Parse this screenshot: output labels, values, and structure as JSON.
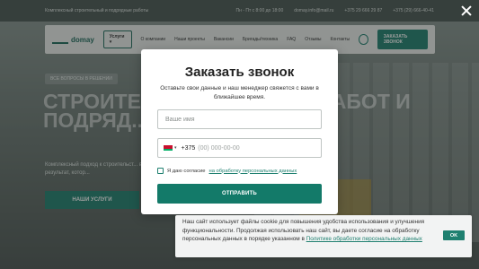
{
  "background": {
    "topbar": {
      "tagline": "Комплексный строительный и подрядные работы",
      "hours": "Пн - Пт с 8:00 до 18:00",
      "email": "domay.info@mail.ru",
      "phone1": "+375 29 666 29 87",
      "phone2": "+375 (29) 666-40-41"
    },
    "header": {
      "logo_text": "domay",
      "services_label": "Услуги ▾",
      "nav": [
        "О компании",
        "Наши проекты",
        "Вакансии",
        "Бригады/техника",
        "FAQ",
        "Отзывы",
        "Контакты"
      ],
      "call_button": "ЗАКАЗАТЬ ЗВОНОК"
    },
    "hero": {
      "badge": "ВСЕ ВОПРОСЫ В РЕШЕНИИ",
      "title": "СТРОИТЕЛ... С ПОЛНЫМ... РАБОТ И ПОДРЯД...",
      "subtitle": "Комплексный подход к строительст... вашего получить результат, котор...",
      "button": "НАШИ УСЛУГИ"
    }
  },
  "modal": {
    "title": "Заказать звонок",
    "subtitle": "Оставьте свои данные и наш менеджер свяжется с вами в ближайшее время.",
    "name_placeholder": "Ваше имя",
    "phone_code": "+375",
    "phone_mask": "(00) 000-00-00",
    "consent_prefix": "Я даю согласие",
    "consent_link": "на обработку персональных данных",
    "submit_label": "ОТПРАВИТЬ"
  },
  "cookie_banner": {
    "text": "Наш сайт использует файлы cookie для повышения удобства использования и улучшения функциональности. Продолжая использовать наш сайт, вы даете согласие на обработку персональных данных в порядке указанном в",
    "link": "Политике обработки персональных данных",
    "ok_label": "OK"
  },
  "colors": {
    "accent": "#1f8070",
    "overlay": "#1e2321"
  }
}
